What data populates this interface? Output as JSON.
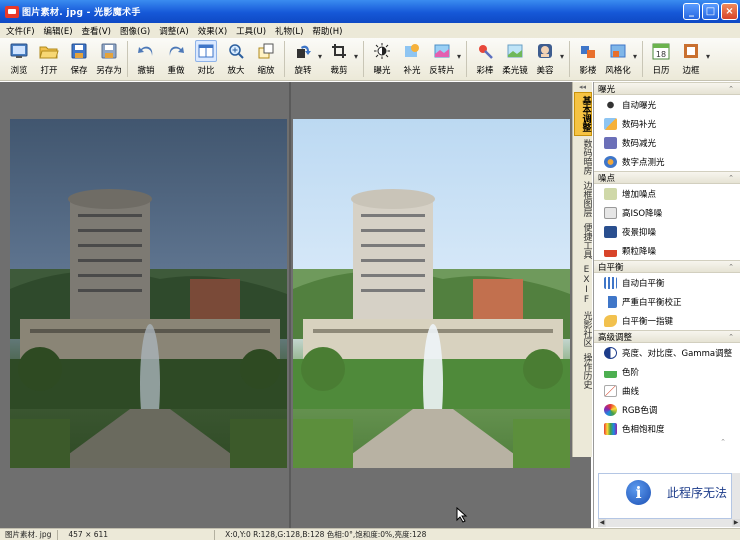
{
  "window": {
    "title": "图片素材. jpg - 光影魔术手",
    "minimize": "_",
    "maximize": "□",
    "close": "×"
  },
  "menu": [
    "文件(F)",
    "编辑(E)",
    "查看(V)",
    "图像(G)",
    "调整(A)",
    "效果(X)",
    "工具(U)",
    "礼物(L)",
    "帮助(H)"
  ],
  "toolbar": {
    "browse": "浏览",
    "open": "打开",
    "save": "保存",
    "save_as": "另存为",
    "undo": "撤销",
    "redo": "重做",
    "compare": "对比",
    "zoom_in": "放大",
    "zoom_out": "缩放",
    "rotate": "旋转",
    "crop": "裁剪",
    "exposure": "曝光",
    "fill_light": "补光",
    "negative": "反转片",
    "color_pen": "彩棒",
    "soft_lens": "柔光镜",
    "beauty": "美容",
    "shadow": "影楼",
    "stylize": "风格化",
    "calendar": "日历",
    "calendar_day": "18",
    "border": "边框"
  },
  "vtabs": [
    "基本调整",
    "数码暗房",
    "边框图层",
    "便捷工具",
    "EXIF",
    "光影社区",
    "操作历史"
  ],
  "panel": {
    "sections": [
      {
        "title": "曝光",
        "items": [
          "自动曝光",
          "数码补光",
          "数码减光",
          "数字点测光"
        ]
      },
      {
        "title": "噪点",
        "items": [
          "增加噪点",
          "高ISO降噪",
          "夜景抑噪",
          "颗粒降噪"
        ]
      },
      {
        "title": "白平衡",
        "items": [
          "自动白平衡",
          "严重白平衡校正",
          "白平衡一指键"
        ]
      },
      {
        "title": "高级调整",
        "items": [
          "亮度、对比度、Gamma调整",
          "色阶",
          "曲线",
          "RGB色调",
          "色相饱和度"
        ]
      }
    ],
    "notice": "此程序无法"
  },
  "status": {
    "filename": "图片素材. jpg",
    "size": "457 × 611",
    "pixel_info": "X:0,Y:0 R:128,G:128,B:128 色相:0°,饱和度:0%,亮度:128"
  },
  "colors": {
    "accent_tab": "#f6c342",
    "titlebar": "#1658d8"
  }
}
